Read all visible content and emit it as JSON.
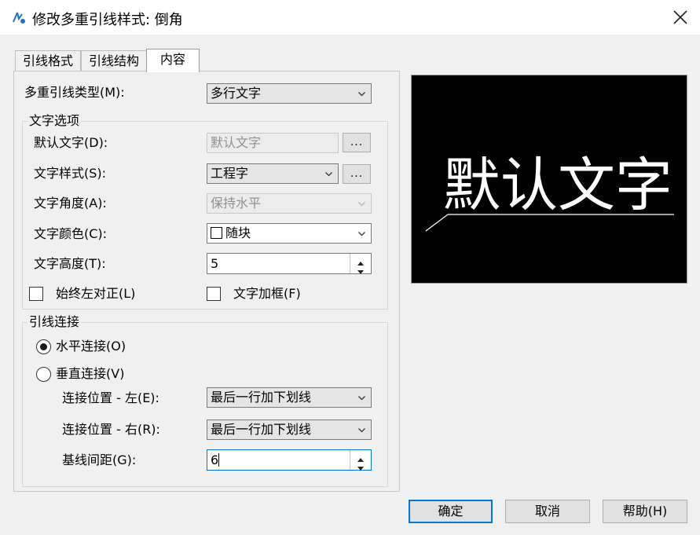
{
  "window": {
    "title": "修改多重引线样式: 倒角",
    "close_icon": "close-icon",
    "app_icon": "multileader-style-icon"
  },
  "tabs": [
    {
      "label": "引线格式",
      "active": false
    },
    {
      "label": "引线结构",
      "active": false
    },
    {
      "label": "内容",
      "active": true
    }
  ],
  "content": {
    "leader_type_label": "多重引线类型(M):",
    "leader_type_value": "多行文字",
    "text_options": {
      "group_label": "文字选项",
      "default_text_label": "默认文字(D):",
      "default_text_value": "默认文字",
      "default_text_button": "...",
      "text_style_label": "文字样式(S):",
      "text_style_value": "工程字",
      "text_style_button": "...",
      "text_angle_label": "文字角度(A):",
      "text_angle_value": "保持水平",
      "text_color_label": "文字颜色(C):",
      "text_color_value": "随块",
      "text_height_label": "文字高度(T):",
      "text_height_value": "5",
      "always_left_label": "始终左对正(L)",
      "always_left_checked": false,
      "frame_text_label": "文字加框(F)",
      "frame_text_checked": false
    },
    "leader_connection": {
      "group_label": "引线连接",
      "horizontal_label": "水平连接(O)",
      "horizontal_selected": true,
      "vertical_label": "垂直连接(V)",
      "vertical_selected": false,
      "attach_left_label": "连接位置 - 左(E):",
      "attach_left_value": "最后一行加下划线",
      "attach_right_label": "连接位置 - 右(R):",
      "attach_right_value": "最后一行加下划线",
      "landing_gap_label": "基线间距(G):",
      "landing_gap_value": "6"
    }
  },
  "preview": {
    "text": "默认文字",
    "background": "#000000",
    "stroke": "#ffffff"
  },
  "buttons": {
    "ok": "确定",
    "cancel": "取消",
    "help": "帮助(H)"
  },
  "colors": {
    "accent": "#0078d7",
    "dialog_bg": "#f0f0f0"
  }
}
